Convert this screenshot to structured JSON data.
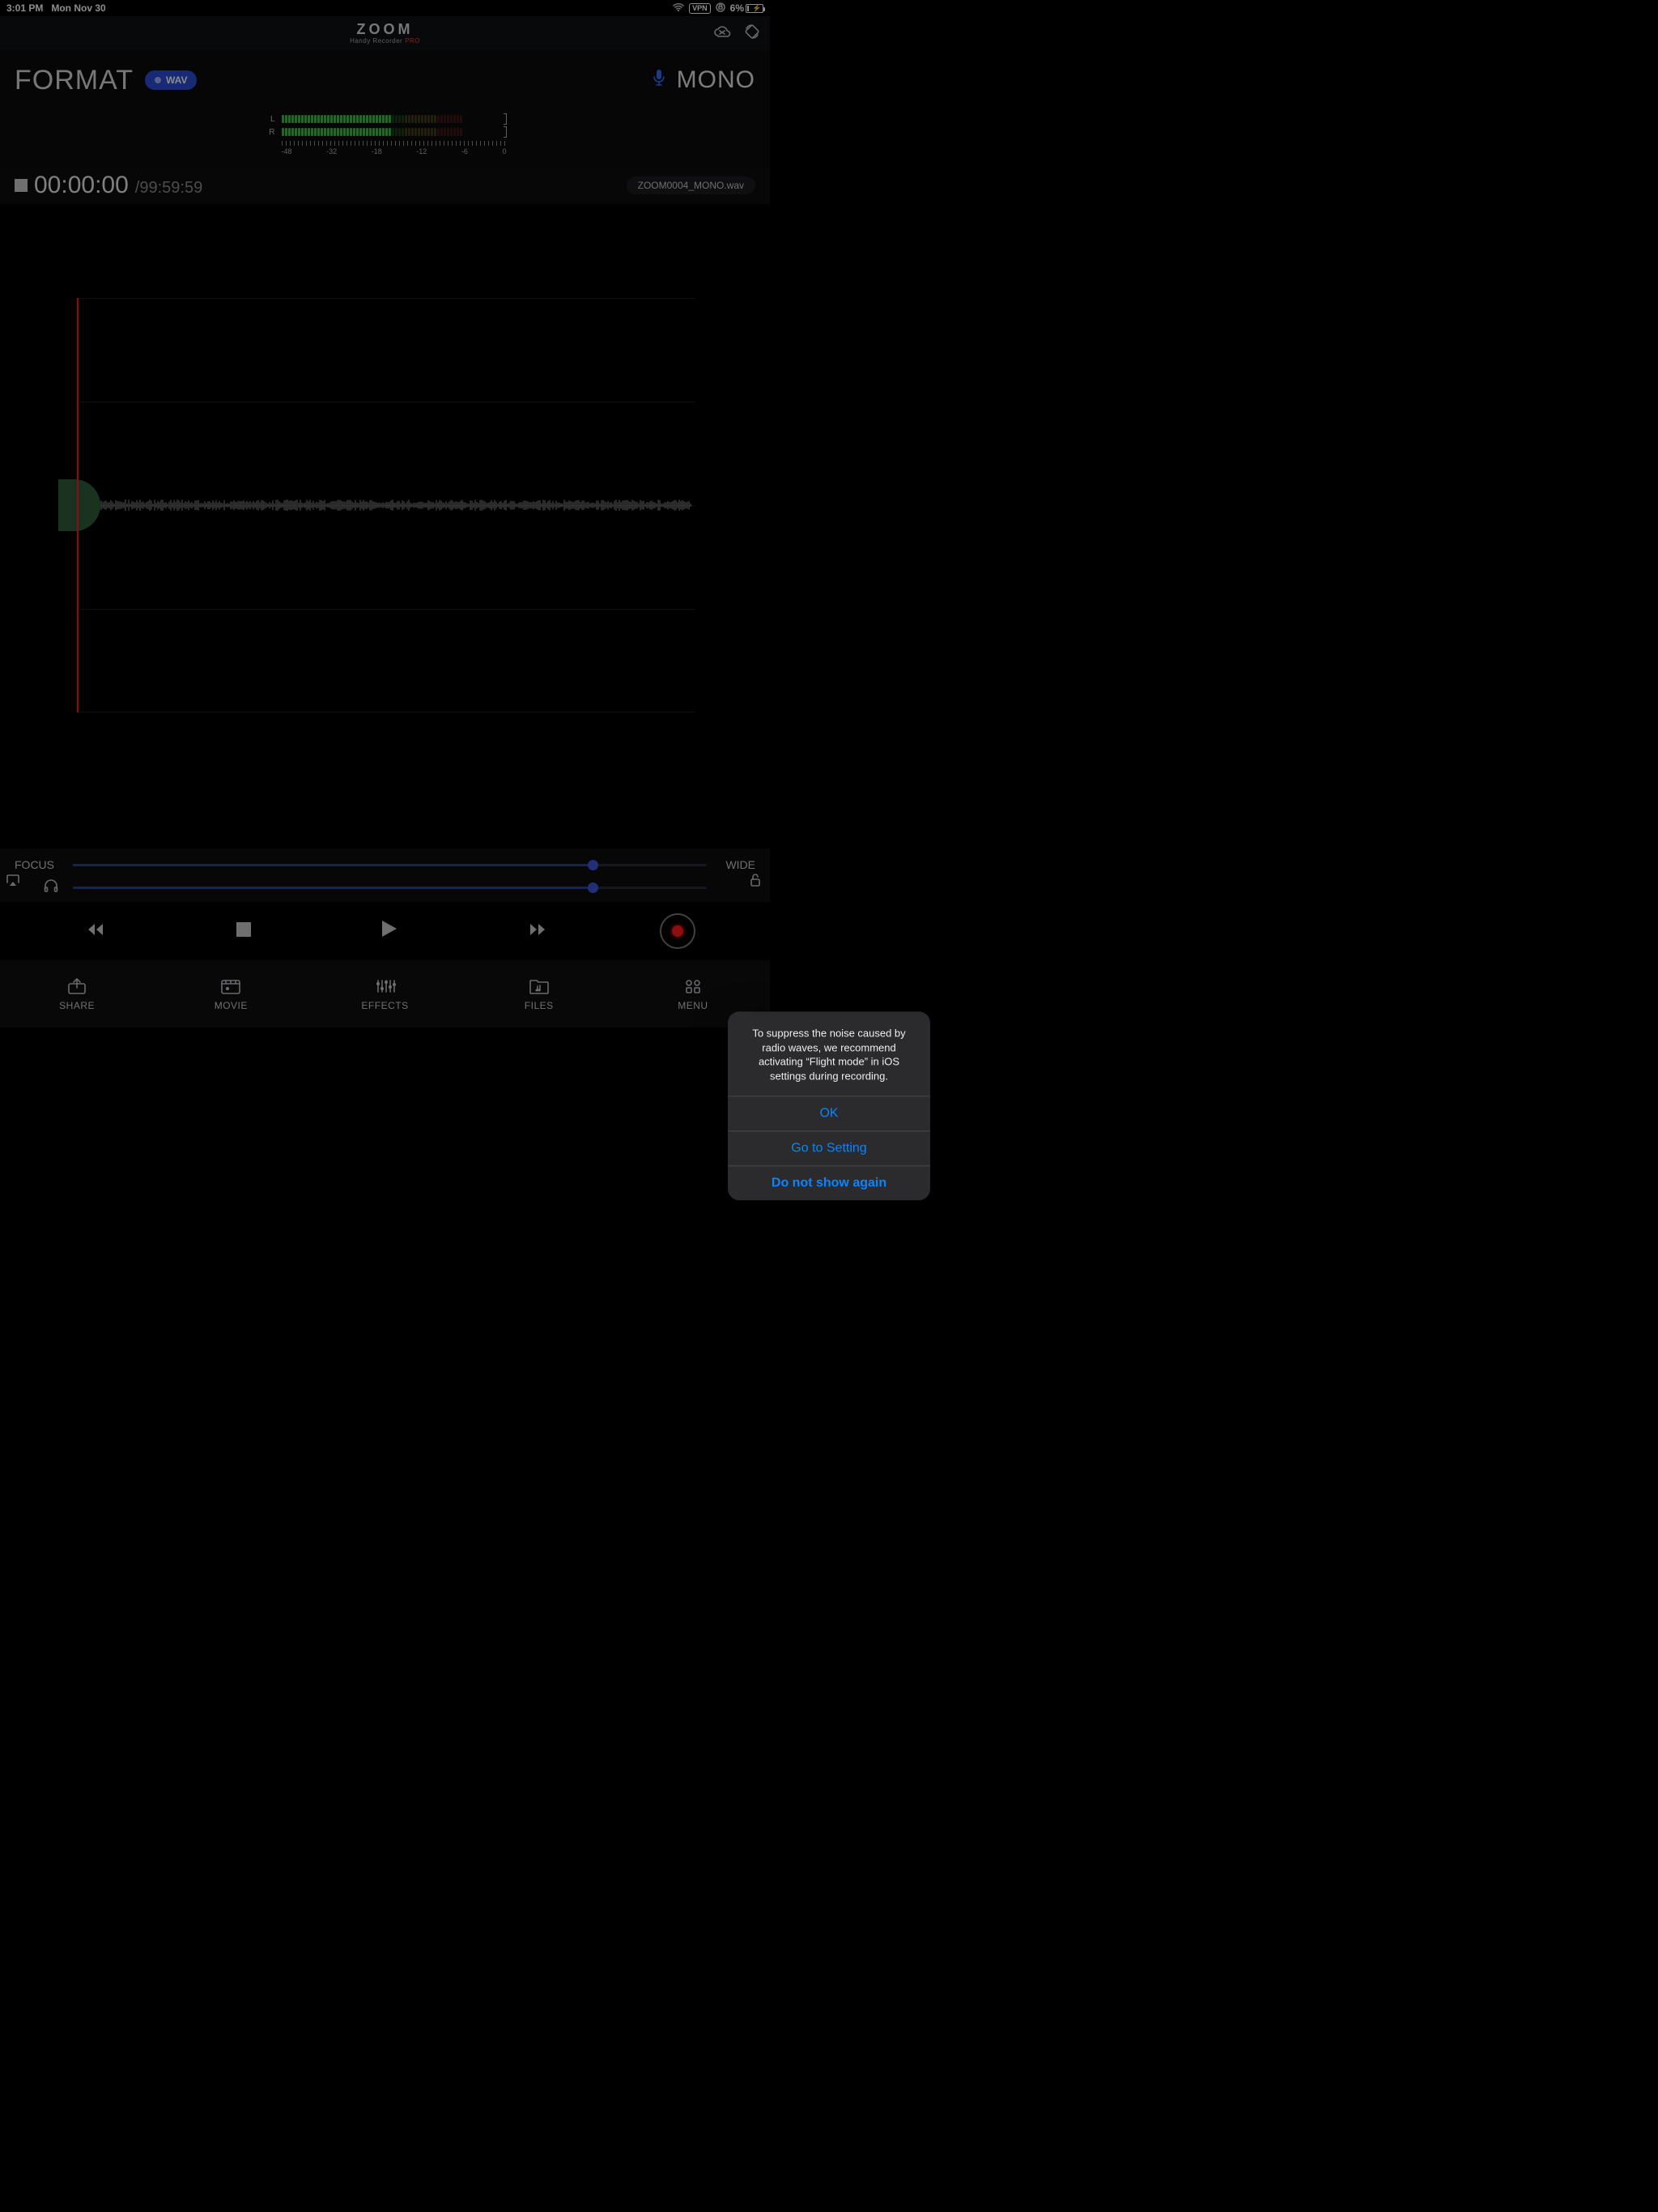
{
  "statusbar": {
    "time": "3:01 PM",
    "date": "Mon Nov 30",
    "vpn": "VPN",
    "battery": "6%"
  },
  "brand": {
    "logo": "ZOOM",
    "sub": "Handy Recorder ",
    "pro": "PRO"
  },
  "format": {
    "title": "FORMAT",
    "pill": "WAV",
    "channel": "MONO"
  },
  "meter": {
    "labels": {
      "l": "L",
      "r": "R"
    },
    "ticks": [
      "-48",
      "-32",
      "-18",
      "-12",
      "-6",
      "0"
    ]
  },
  "time": {
    "current": "00:00:00",
    "sep": "/",
    "total": "99:59:59",
    "file": "ZOOM0004_MONO.wav"
  },
  "sliders": {
    "focus": "FOCUS",
    "wide": "WIDE",
    "pos1": 82,
    "pos2": 82
  },
  "nav": {
    "share": "SHARE",
    "movie": "MOVIE",
    "effects": "EFFECTS",
    "files": "FILES",
    "menu": "MENU"
  },
  "dialog": {
    "msg": "To suppress the noise caused by radio waves, we recommend activating “Flight mode” in iOS settings during recording.",
    "ok": "OK",
    "setting": "Go to Setting",
    "dont": "Do not show again"
  }
}
